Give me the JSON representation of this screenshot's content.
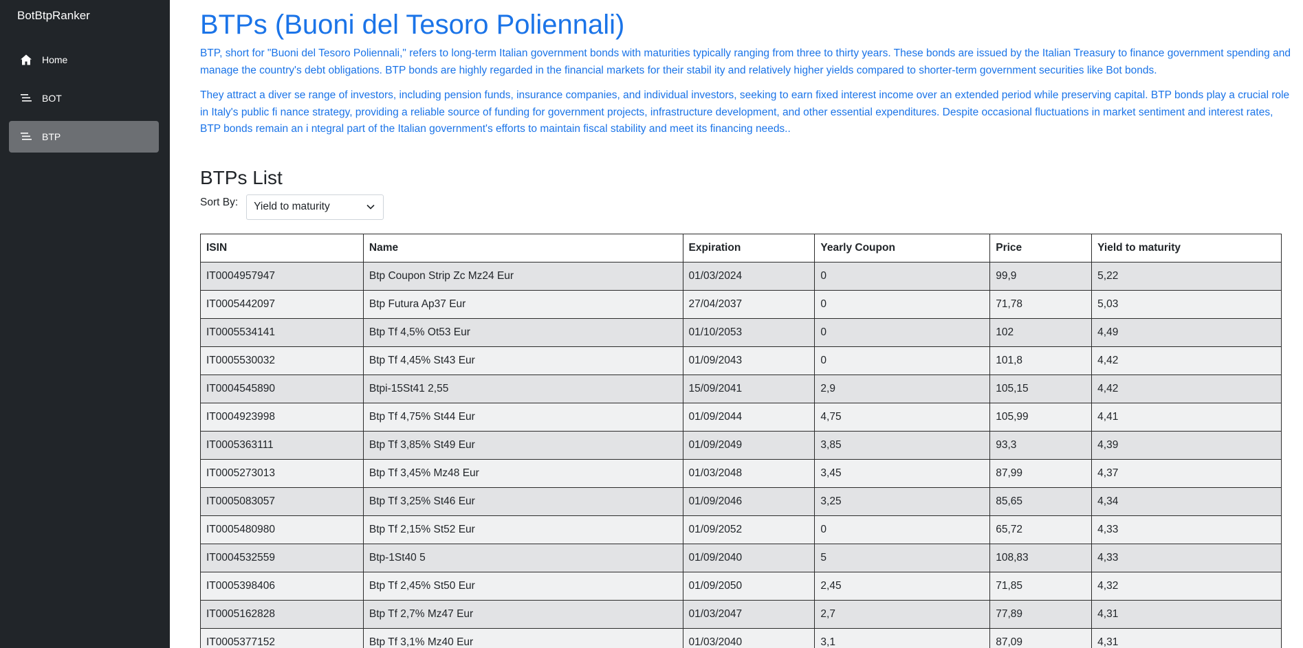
{
  "sidebar": {
    "brand": "BotBtpRanker",
    "items": [
      {
        "label": "Home",
        "icon": "home-icon"
      },
      {
        "label": "BOT",
        "icon": "list-icon"
      },
      {
        "label": "BTP",
        "icon": "list-icon",
        "active": true
      }
    ]
  },
  "header": {
    "title": "BTPs (Buoni del Tesoro Poliennali)",
    "paragraph1": "BTP, short for \"Buoni del Tesoro Poliennali,\" refers to long-term Italian government bonds with maturities typically ranging from three to thirty years. These bonds are issued by the Italian Treasury to finance government spending and manage the country's debt obligations. BTP bonds are highly regarded in the financial markets for their stabil ity and relatively higher yields compared to shorter-term government securities like Bot bonds.",
    "paragraph2": "They attract a diver se range of investors, including pension funds, insurance companies, and individual investors, seeking to earn fixed interest income over an extended period while preserving capital. BTP bonds play a crucial role in Italy's public fi nance strategy, providing a reliable source of funding for government projects, infrastructure development, and other essential expenditures. Despite occasional fluctuations in market sentiment and interest rates, BTP bonds remain an i ntegral part of the Italian government's efforts to maintain fiscal stability and meet its financing needs.."
  },
  "list": {
    "title": "BTPs List",
    "sort_label": "Sort By:",
    "sort_value": "Yield to maturity",
    "columns": [
      "ISIN",
      "Name",
      "Expiration",
      "Yearly Coupon",
      "Price",
      "Yield to maturity"
    ],
    "rows": [
      [
        "IT0004957947",
        "Btp Coupon Strip Zc Mz24 Eur",
        "01/03/2024",
        "0",
        "99,9",
        "5,22"
      ],
      [
        "IT0005442097",
        "Btp Futura Ap37 Eur",
        "27/04/2037",
        "0",
        "71,78",
        "5,03"
      ],
      [
        "IT0005534141",
        "Btp Tf 4,5% Ot53 Eur",
        "01/10/2053",
        "0",
        "102",
        "4,49"
      ],
      [
        "IT0005530032",
        "Btp Tf 4,45% St43 Eur",
        "01/09/2043",
        "0",
        "101,8",
        "4,42"
      ],
      [
        "IT0004545890",
        "Btpi-15St41 2,55",
        "15/09/2041",
        "2,9",
        "105,15",
        "4,42"
      ],
      [
        "IT0004923998",
        "Btp Tf 4,75% St44 Eur",
        "01/09/2044",
        "4,75",
        "105,99",
        "4,41"
      ],
      [
        "IT0005363111",
        "Btp Tf 3,85% St49 Eur",
        "01/09/2049",
        "3,85",
        "93,3",
        "4,39"
      ],
      [
        "IT0005273013",
        "Btp Tf 3,45% Mz48 Eur",
        "01/03/2048",
        "3,45",
        "87,99",
        "4,37"
      ],
      [
        "IT0005083057",
        "Btp Tf 3,25% St46 Eur",
        "01/09/2046",
        "3,25",
        "85,65",
        "4,34"
      ],
      [
        "IT0005480980",
        "Btp Tf 2,15% St52 Eur",
        "01/09/2052",
        "0",
        "65,72",
        "4,33"
      ],
      [
        "IT0004532559",
        "Btp-1St40 5",
        "01/09/2040",
        "5",
        "108,83",
        "4,33"
      ],
      [
        "IT0005398406",
        "Btp Tf 2,45% St50 Eur",
        "01/09/2050",
        "2,45",
        "71,85",
        "4,32"
      ],
      [
        "IT0005162828",
        "Btp Tf 2,7% Mz47 Eur",
        "01/03/2047",
        "2,7",
        "77,89",
        "4,31"
      ],
      [
        "IT0005377152",
        "Btp Tf 3,1% Mz40 Eur",
        "01/03/2040",
        "3,1",
        "87,09",
        "4,31"
      ]
    ]
  }
}
